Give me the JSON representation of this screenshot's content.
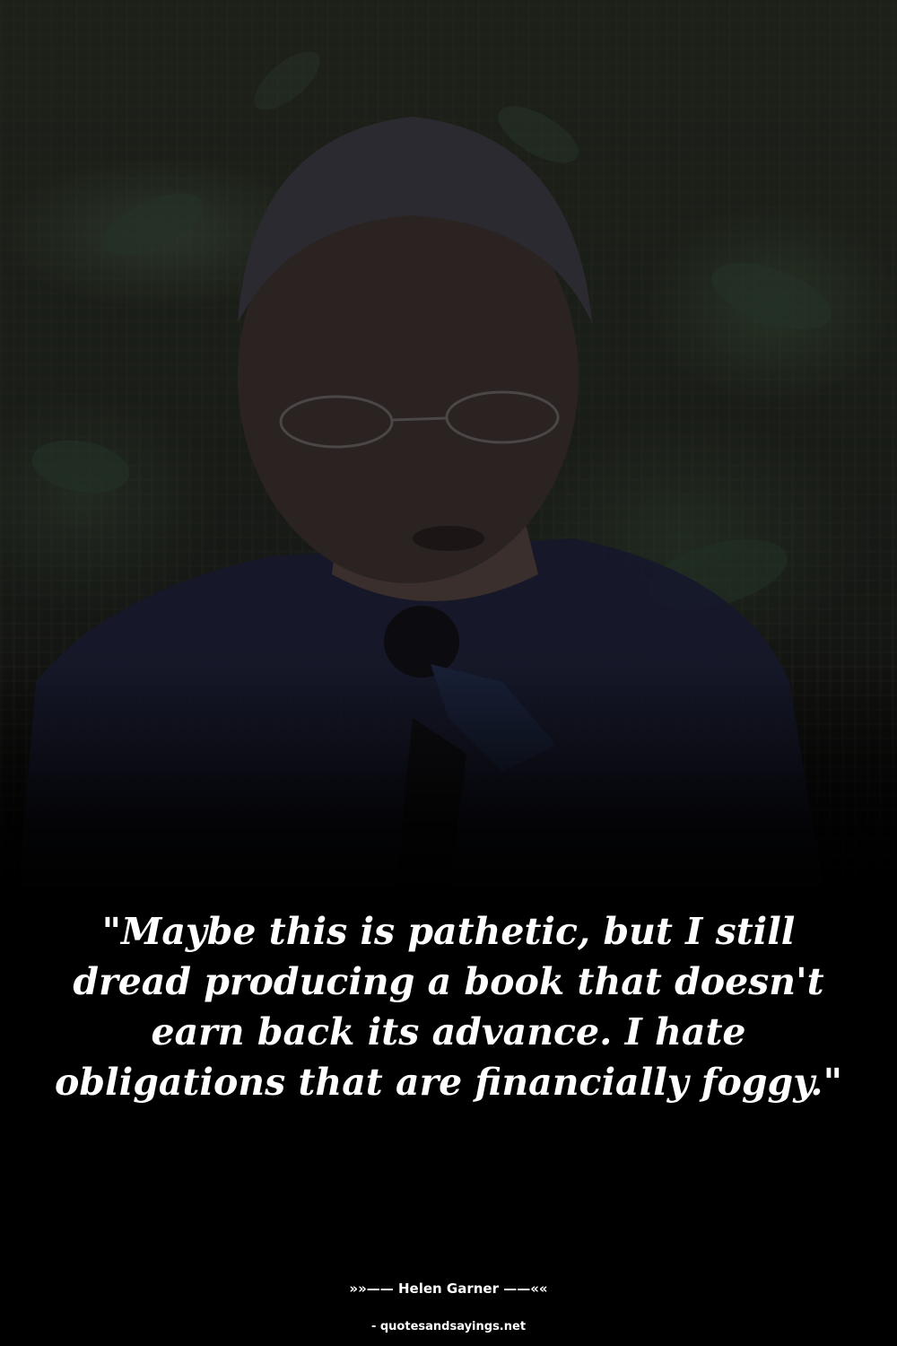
{
  "background": {
    "image": "photo-of-speaker-with-microphone",
    "overlay_color": "#000000"
  },
  "quote": {
    "text": "\"Maybe this is pathetic, but I still dread producing a book that doesn't earn back its advance. I hate obligations that are financially foggy.\""
  },
  "author": {
    "line": "»»—— Helen Garner ——««"
  },
  "source": {
    "line": "- quotesandsayings.net"
  },
  "colors": {
    "text": "#ffffff",
    "background": "#000000"
  }
}
